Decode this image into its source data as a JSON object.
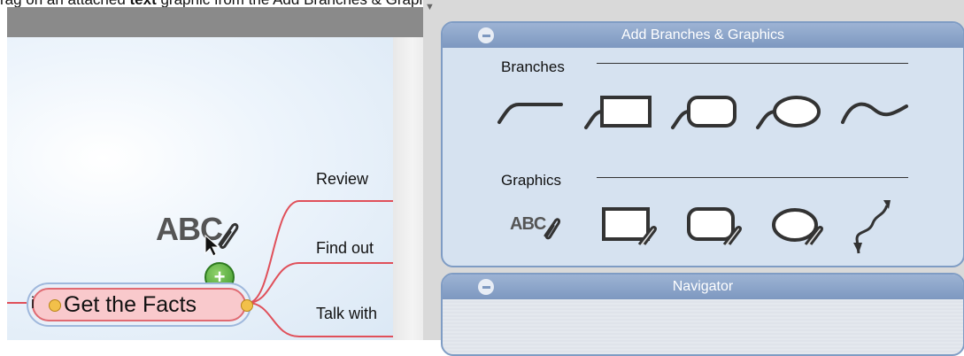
{
  "caption": {
    "prefix": "rag on an attached ",
    "bold": "text",
    "suffix": " graphic from the Add Branches & Graphics palette."
  },
  "mindmap": {
    "topic_label": "Get the Facts",
    "topic_info_marker": "i",
    "branch_labels": [
      "Review",
      "Find out",
      "Talk with"
    ],
    "drag_graphic_text": "ABC",
    "add_badge": "+"
  },
  "palette": {
    "title": "Add Branches & Graphics",
    "branches_label": "Branches",
    "graphics_label": "Graphics",
    "graphic_text_icon_label": "ABC",
    "branch_tools": [
      "line-branch-icon",
      "rectangle-branch-icon",
      "rounded-rect-branch-icon",
      "oval-branch-icon",
      "wave-branch-icon"
    ],
    "graphic_tools": [
      "text-graphic-icon",
      "rectangle-graphic-icon",
      "rounded-rect-graphic-icon",
      "oval-graphic-icon",
      "arrow-graphic-icon"
    ]
  },
  "navigator": {
    "title": "Navigator"
  },
  "colors": {
    "panel_border": "#7f9cc4",
    "panel_header": "#8ca6cc",
    "branch_line": "#e0505a",
    "topic_fill": "#f9c9cc"
  }
}
